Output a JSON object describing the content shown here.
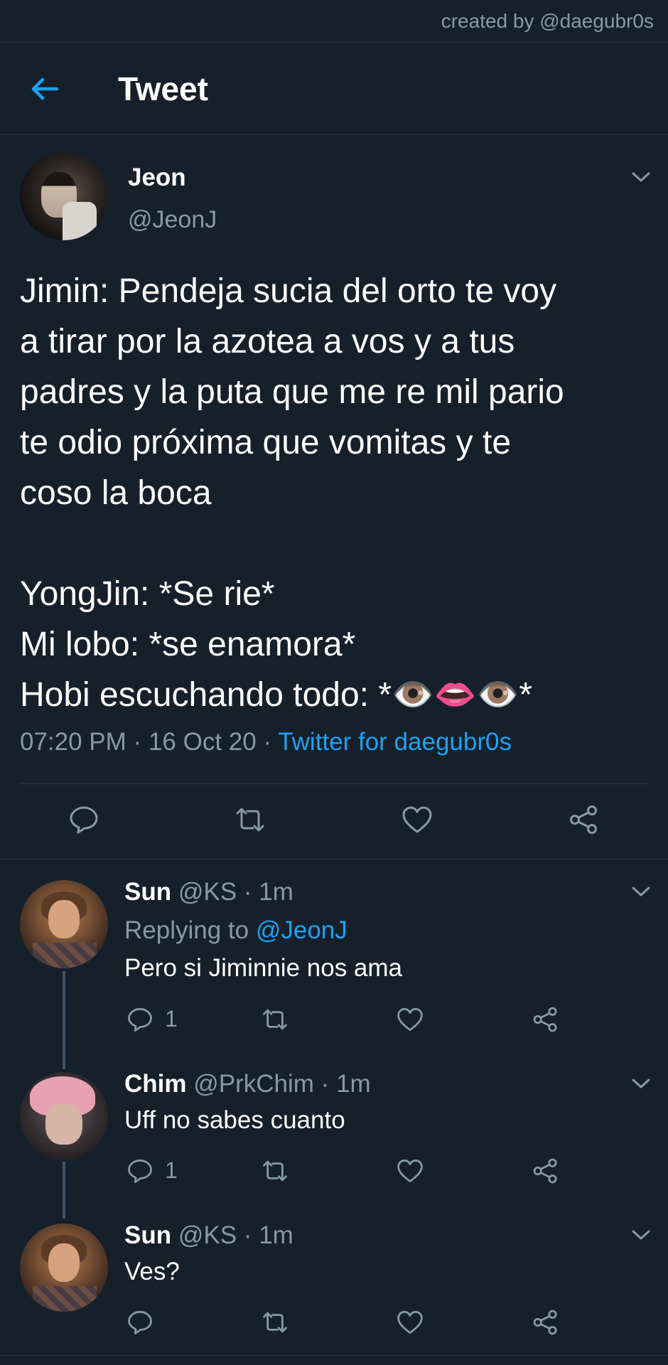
{
  "credit": "created by @daegubr0s",
  "header": {
    "title": "Tweet"
  },
  "tweet": {
    "name": "Jeon",
    "handle": "@JeonJ",
    "text": "Jimin: Pendeja sucia del orto te voy\na tirar por la azotea a vos y a tus\npadres y la puta que me re mil pario\nte odio próxima que vomitas y te\ncoso la boca\n\nYongJin: *Se rie*\nMi lobo: *se enamora*\nHobi escuchando todo: *👁️👄👁️*",
    "time": "07:20 PM",
    "date": "16 Oct 20",
    "source": "Twitter for daegubr0s"
  },
  "replies": [
    {
      "name": "Sun",
      "handle": "@KS",
      "age": "1m",
      "replying_label": "Replying to",
      "replying_to": "@JeonJ",
      "text": "Pero si Jiminnie nos ama",
      "reply_count": "1"
    },
    {
      "name": "Chim",
      "handle": "@PrkChim",
      "age": "1m",
      "text": "Uff no sabes cuanto",
      "reply_count": "1"
    },
    {
      "name": "Sun",
      "handle": "@KS",
      "age": "1m",
      "text": "Ves?",
      "reply_count": ""
    }
  ],
  "colors": {
    "background": "#15202b",
    "accent": "#1da1f2",
    "secondary_text": "#8899a6",
    "divider": "#253341"
  },
  "icons": [
    "back-arrow-icon",
    "chevron-down-icon",
    "reply-icon",
    "retweet-icon",
    "like-icon",
    "share-icon"
  ]
}
